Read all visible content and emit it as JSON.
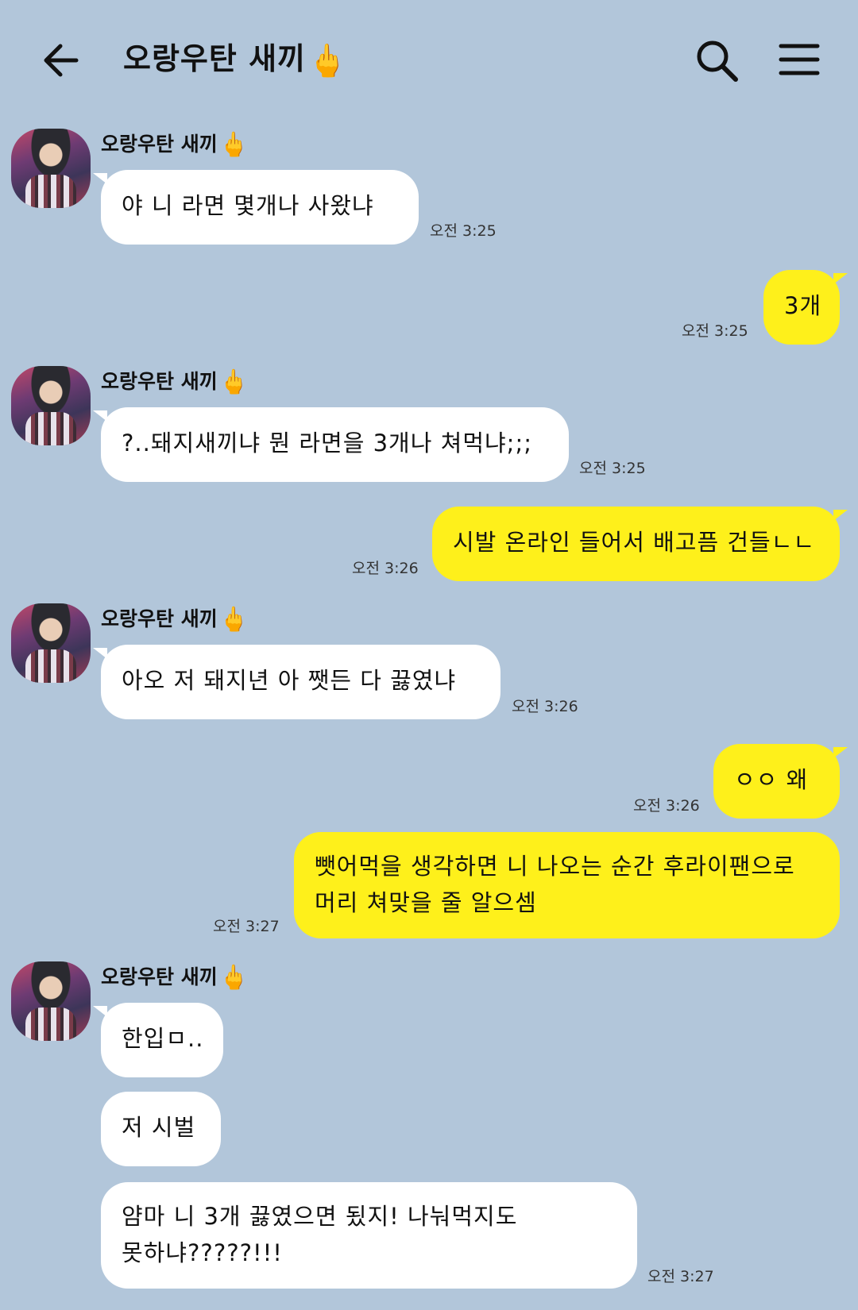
{
  "header": {
    "title": "오랑우탄 새끼",
    "title_emoji": "🖕",
    "back_icon": "arrow-left-icon",
    "search_icon": "search-icon",
    "menu_icon": "hamburger-menu-icon"
  },
  "colors": {
    "background": "#b2c6da",
    "incoming_bubble": "#ffffff",
    "outgoing_bubble": "#fef01b"
  },
  "messages": [
    {
      "sender": "오랑우탄 새끼",
      "sender_emoji": "🖕",
      "direction": "in",
      "text": "야 니 라면 몇개나 사왔냐",
      "time": "오전 3:25"
    },
    {
      "direction": "out",
      "text": "3개",
      "time": "오전 3:25"
    },
    {
      "sender": "오랑우탄 새끼",
      "sender_emoji": "🖕",
      "direction": "in",
      "text": "?..돼지새끼냐 뭔 라면을 3개나 쳐먹냐;;;",
      "time": "오전 3:25"
    },
    {
      "direction": "out",
      "text": "시발 온라인 들어서 배고픔 건들ㄴㄴ",
      "time": "오전 3:26"
    },
    {
      "sender": "오랑우탄 새끼",
      "sender_emoji": "🖕",
      "direction": "in",
      "text": "아오 저 돼지년 아 쨋든 다 끓였냐",
      "time": "오전 3:26"
    },
    {
      "direction": "out",
      "text": "ㅇㅇ 왜",
      "time": "오전 3:26"
    },
    {
      "direction": "out",
      "line1": "뺏어먹을 생각하면 니 나오는 순간 후라이팬으로",
      "line2": "머리 쳐맞을 줄 알으셈",
      "time": "오전 3:27"
    },
    {
      "sender": "오랑우탄 새끼",
      "sender_emoji": "🖕",
      "direction": "in",
      "text": "한입ㅁ.."
    },
    {
      "direction": "in",
      "text": "저 시벌"
    },
    {
      "direction": "in",
      "line1": "얌마 니 3개 끓였으면 됬지! 나눠먹지도",
      "line2": "못하냐?????!!!",
      "time": "오전 3:27"
    }
  ]
}
